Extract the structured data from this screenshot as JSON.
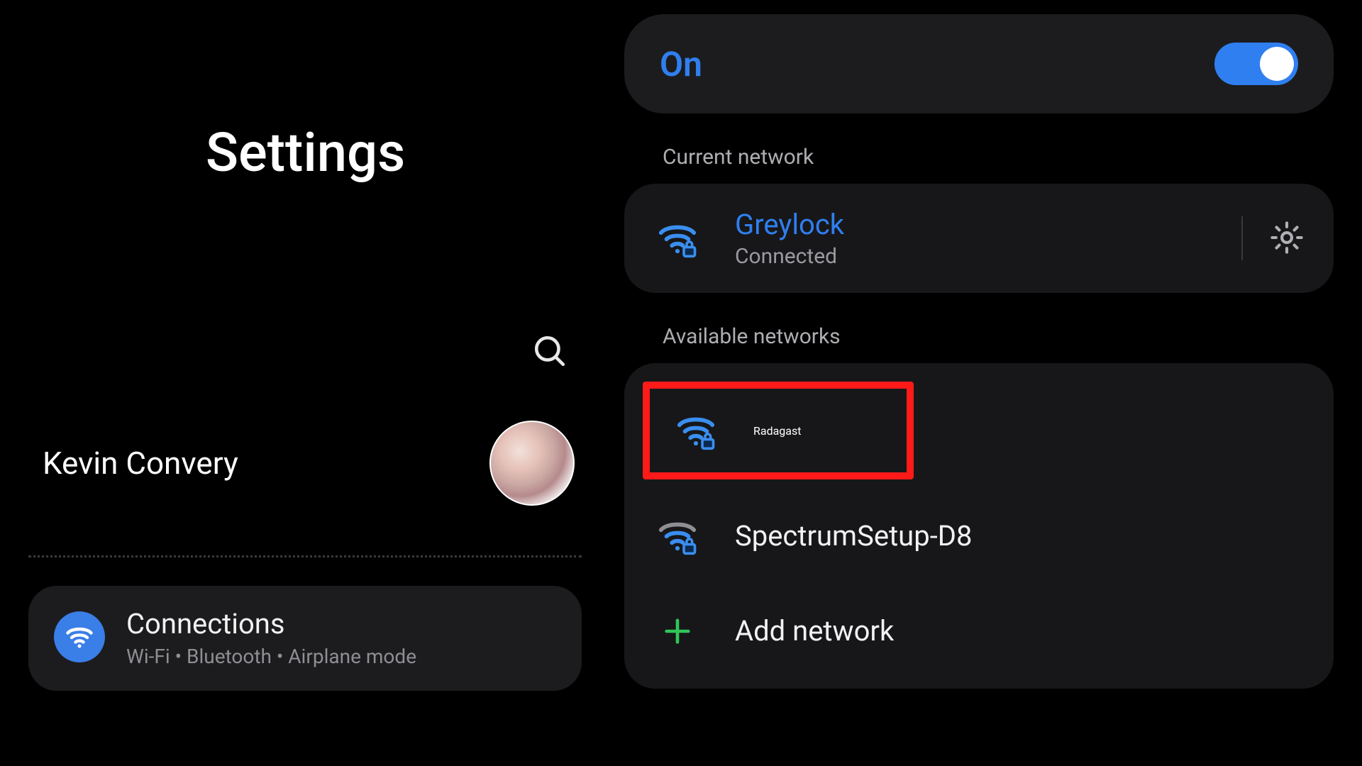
{
  "left": {
    "title": "Settings",
    "user_name": "Kevin Convery",
    "connections": {
      "title": "Connections",
      "subtitle": "Wi-Fi  •  Bluetooth  •  Airplane mode"
    }
  },
  "right": {
    "wifi_toggle_label": "On",
    "wifi_toggle_on": true,
    "current_section_label": "Current network",
    "current_network": {
      "name": "Greylock",
      "status": "Connected"
    },
    "available_section_label": "Available networks",
    "available": [
      {
        "name": "Radagast",
        "highlighted": true
      },
      {
        "name": "SpectrumSetup-D8",
        "highlighted": false
      }
    ],
    "add_network_label": "Add network"
  }
}
